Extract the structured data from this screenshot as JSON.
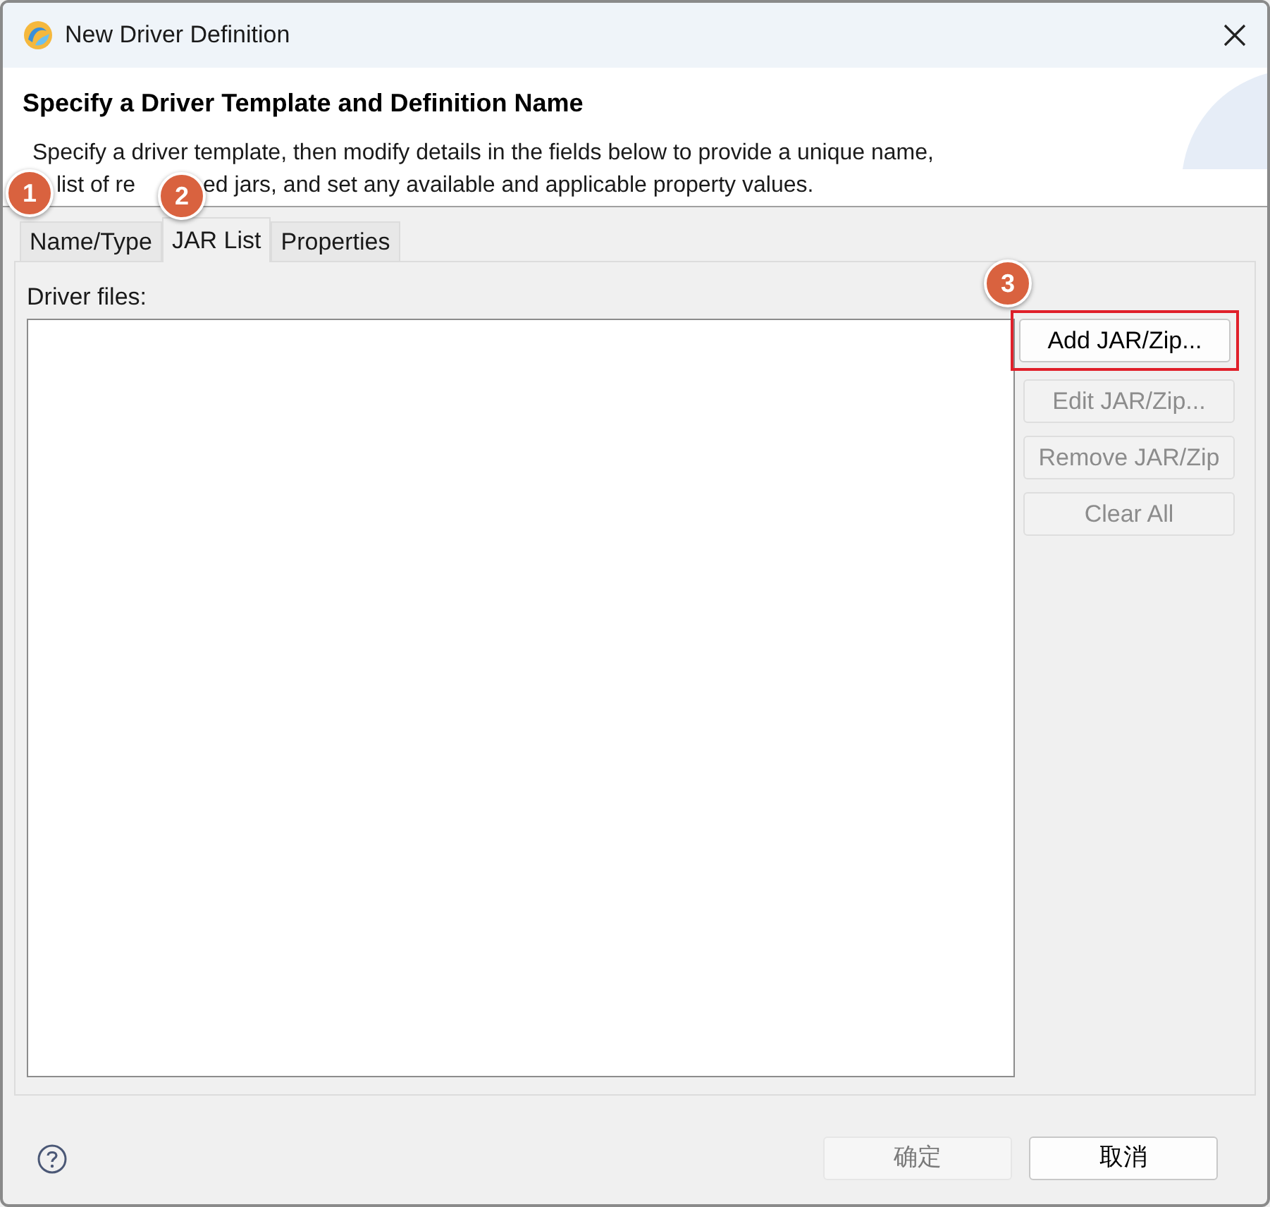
{
  "window": {
    "title": "New Driver Definition"
  },
  "header": {
    "title": "Specify a Driver Template and Definition Name",
    "description_line_1": "Specify a driver template, then modify details in the fields below to provide a unique name,",
    "description_line_2_parts": [
      "list of re",
      "ed jars, and set any available and applicable property values."
    ]
  },
  "tabs": [
    {
      "label": "Name/Type",
      "selected": false
    },
    {
      "label": "JAR List",
      "selected": true
    },
    {
      "label": "Properties",
      "selected": false
    }
  ],
  "driver_files": {
    "label": "Driver files:"
  },
  "buttons": [
    {
      "label": "Add JAR/Zip...",
      "disabled": false,
      "highlighted": true
    },
    {
      "label": "Edit JAR/Zip...",
      "disabled": true,
      "highlighted": false
    },
    {
      "label": "Remove JAR/Zip",
      "disabled": true,
      "highlighted": false
    },
    {
      "label": "Clear All",
      "disabled": true,
      "highlighted": false
    }
  ],
  "footer_buttons": [
    {
      "label": "确定",
      "disabled": true
    },
    {
      "label": "取消",
      "disabled": false
    }
  ],
  "annotations": [
    {
      "number": "1"
    },
    {
      "number": "2"
    },
    {
      "number": "3"
    }
  ]
}
